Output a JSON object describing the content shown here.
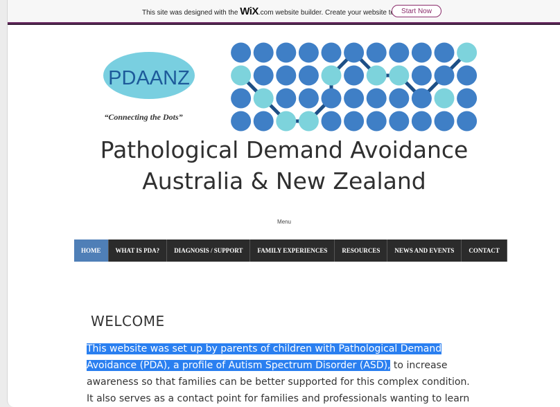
{
  "wix_banner": {
    "text_before": "This site was designed with the ",
    "logo": "WiX",
    "text_after": ".com website builder. Create your website today.",
    "button_label": "Start Now"
  },
  "logo": {
    "name": "PDAANZ",
    "tagline": "“Connecting the Dots”",
    "dot_color": "#3f7fc6",
    "highlight_dot_color": "#7dd3dc",
    "line_color": "#1d4f86",
    "oval_color": "#79cfe0"
  },
  "site": {
    "title_line1": "Pathological Demand Avoidance",
    "title_line2": "Australia & New Zealand",
    "menu_label": "Menu"
  },
  "nav": {
    "items": [
      "HOME",
      "WHAT IS PDA?",
      "DIAGNOSIS / SUPPORT",
      "FAMILY EXPERIENCES",
      "RESOURCES",
      "NEWS AND EVENTS",
      "CONTACT"
    ],
    "active_color": "#4f7fb7",
    "bg_color": "#2b2b2b"
  },
  "content": {
    "heading": "WELCOME",
    "intro_highlighted": "This website was set up by parents of children with Pathological Demand Avoidance (PDA), a profile of Autism Spectrum Disorder (ASD),",
    "intro_rest": " to increase awareness so that families can be better supported for this complex condition. It also serves as a contact point for families and professionals wanting to learn about"
  }
}
